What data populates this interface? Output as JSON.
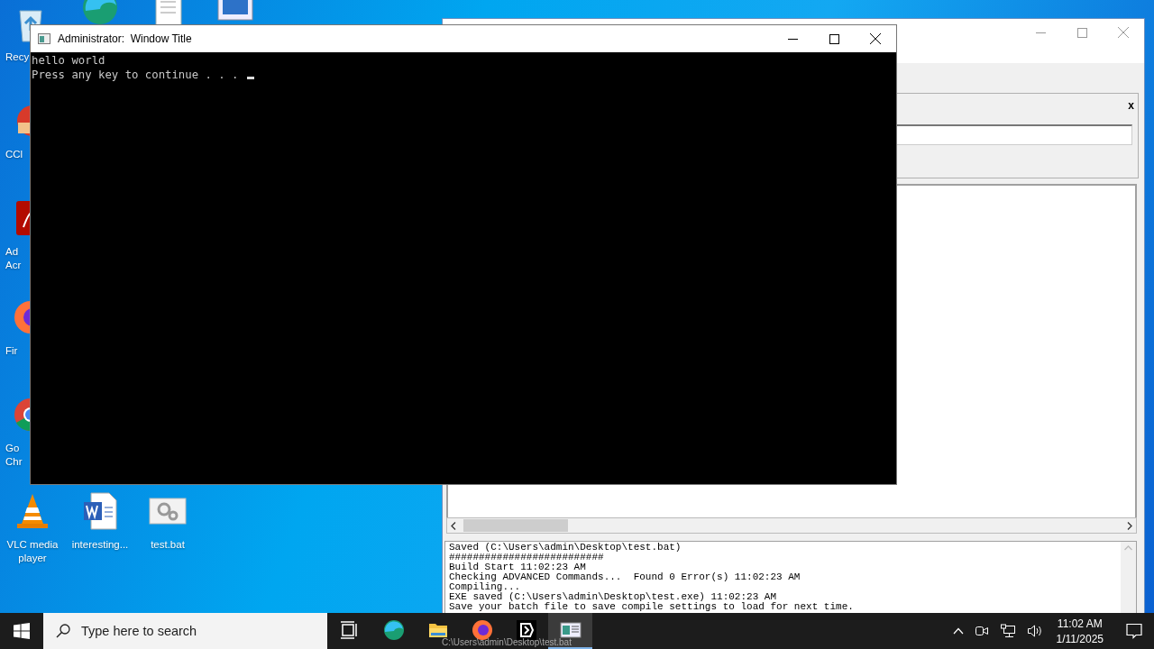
{
  "desktop": {
    "icons": [
      {
        "kind": "recycle",
        "lines": [
          "Recy"
        ]
      },
      {
        "kind": "edge"
      },
      {
        "kind": "document"
      },
      {
        "kind": "window"
      },
      {
        "kind": "ccleaner",
        "lines": [
          "CCl"
        ]
      },
      {
        "kind": "acrobat",
        "lines": [
          "Ad",
          "Acr"
        ]
      },
      {
        "kind": "firefox",
        "lines": [
          "Fir"
        ]
      },
      {
        "kind": "chrome",
        "lines": [
          "Go",
          "Chr"
        ]
      },
      {
        "kind": "vlc",
        "lines": [
          "VLC media",
          "player"
        ]
      },
      {
        "kind": "word",
        "lines": [
          "interesting..."
        ]
      },
      {
        "kind": "batch",
        "lines": [
          "test.bat"
        ]
      }
    ]
  },
  "compiler_window": {
    "log": [
      "Saved (C:\\Users\\admin\\Desktop\\test.bat)",
      "##########################",
      "Build Start 11:02:23 AM",
      "Checking ADVANCED Commands...  Found 0 Error(s) 11:02:23 AM",
      "Compiling...",
      "EXE saved (C:\\Users\\admin\\Desktop\\test.exe) 11:02:23 AM",
      "Save your batch file to save compile settings to load for next time."
    ],
    "panel_close": "x"
  },
  "console_window": {
    "title": "Administrator:  Window Title",
    "lines": [
      "hello world",
      "Press any key to continue . . . "
    ]
  },
  "tooltip": "C:\\Users\\admin\\Desktop\\test.bat",
  "taskbar": {
    "search": {
      "placeholder": "Type here to search"
    },
    "apps": [
      {
        "kind": "taskview",
        "selected": false
      },
      {
        "kind": "edge",
        "selected": false
      },
      {
        "kind": "explorer",
        "selected": false
      },
      {
        "kind": "firefox",
        "selected": false
      },
      {
        "kind": "compiler",
        "selected": false
      },
      {
        "kind": "console",
        "selected": true
      }
    ],
    "time": "11:02 AM",
    "date": "1/11/2025"
  }
}
